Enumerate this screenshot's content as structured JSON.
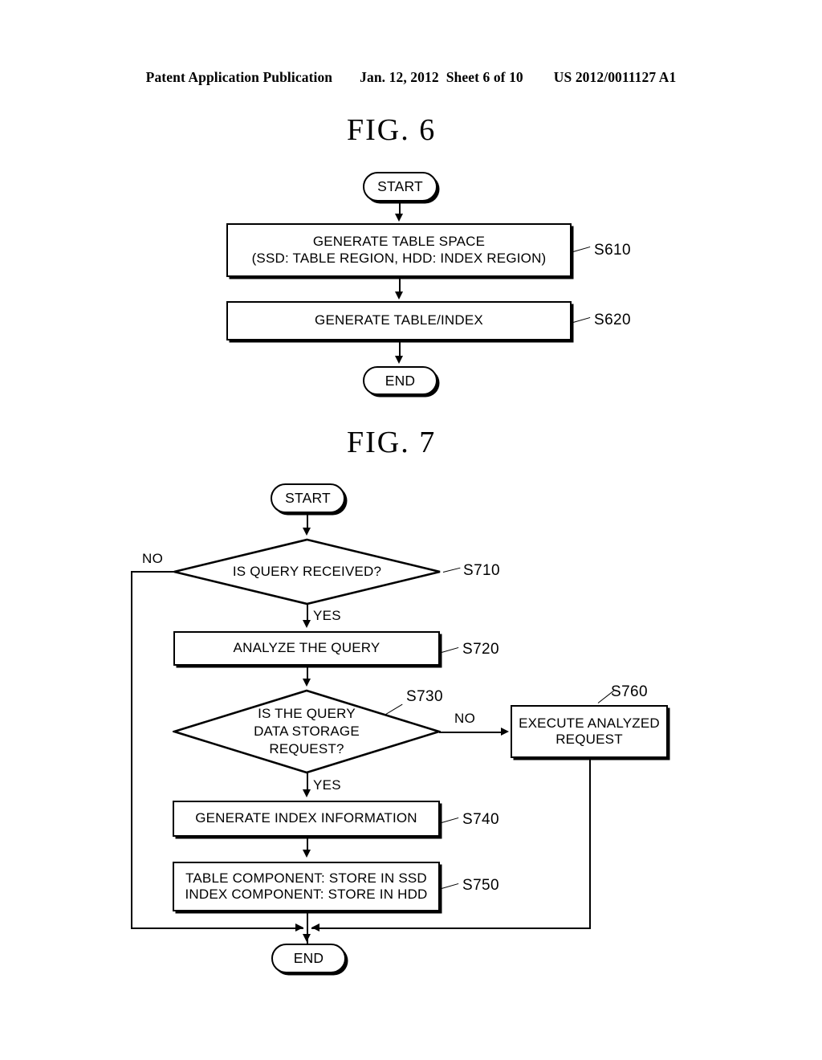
{
  "header": {
    "publication": "Patent Application Publication",
    "date": "Jan. 12, 2012",
    "sheet": "Sheet 6 of 10",
    "patent_number": "US 2012/0011127 A1"
  },
  "figures": [
    {
      "title": "FIG.  6",
      "nodes": {
        "start": "START",
        "s610": "GENERATE TABLE SPACE\n(SSD: TABLE REGION, HDD: INDEX REGION)",
        "s620": "GENERATE TABLE/INDEX",
        "end": "END"
      },
      "step_labels": {
        "s610": "S610",
        "s620": "S620"
      }
    },
    {
      "title": "FIG.  7",
      "nodes": {
        "start": "START",
        "s710": "IS QUERY RECEIVED?",
        "s720": "ANALYZE THE QUERY",
        "s730": "IS THE QUERY\nDATA STORAGE\nREQUEST?",
        "s740": "GENERATE INDEX INFORMATION",
        "s750": "TABLE COMPONENT: STORE IN SSD\nINDEX COMPONENT: STORE IN HDD",
        "s760": "EXECUTE ANALYZED\nREQUEST",
        "end": "END"
      },
      "step_labels": {
        "s710": "S710",
        "s720": "S720",
        "s730": "S730",
        "s740": "S740",
        "s750": "S750",
        "s760": "S760"
      },
      "branch_labels": {
        "s710_no": "NO",
        "s710_yes": "YES",
        "s730_no": "NO",
        "s730_yes": "YES"
      }
    }
  ]
}
